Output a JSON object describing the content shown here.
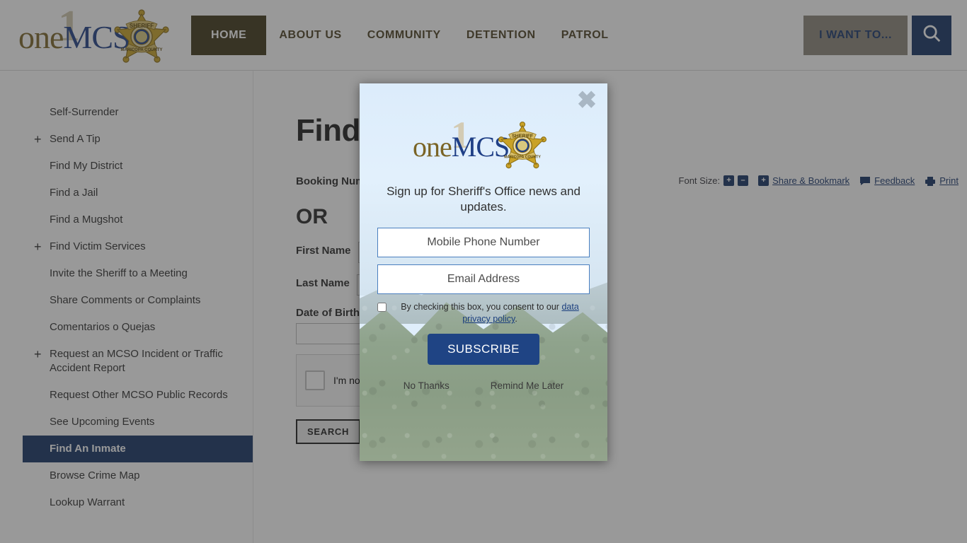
{
  "header": {
    "logo": {
      "digit": "1",
      "one": "one",
      "mcso": "MCSO",
      "badge_top": "SHERIFF",
      "badge_bottom": "MARICOPA COUNTY"
    },
    "nav": [
      {
        "label": "HOME",
        "active": true
      },
      {
        "label": "ABOUT US",
        "active": false
      },
      {
        "label": "COMMUNITY",
        "active": false
      },
      {
        "label": "DETENTION",
        "active": false
      },
      {
        "label": "PATROL",
        "active": false
      }
    ],
    "want_to_label": "I WANT TO...",
    "search_icon": "search-icon"
  },
  "sidebar": {
    "items": [
      {
        "label": "Self-Surrender",
        "expandable": false,
        "active": false
      },
      {
        "label": "Send A Tip",
        "expandable": true,
        "active": false
      },
      {
        "label": "Find My District",
        "expandable": false,
        "active": false
      },
      {
        "label": "Find a Jail",
        "expandable": false,
        "active": false
      },
      {
        "label": "Find a Mugshot",
        "expandable": false,
        "active": false
      },
      {
        "label": "Find Victim Services",
        "expandable": true,
        "active": false
      },
      {
        "label": "Invite the Sheriff to a Meeting",
        "expandable": false,
        "active": false
      },
      {
        "label": "Share Comments or Complaints",
        "expandable": false,
        "active": false
      },
      {
        "label": "Comentarios o Quejas",
        "expandable": false,
        "active": false
      },
      {
        "label": "Request an MCSO Incident or Traffic Accident Report",
        "expandable": true,
        "active": false
      },
      {
        "label": "Request Other MCSO Public Records",
        "expandable": false,
        "active": false
      },
      {
        "label": "See Upcoming Events",
        "expandable": false,
        "active": false
      },
      {
        "label": "Find An Inmate",
        "expandable": false,
        "active": true
      },
      {
        "label": "Browse Crime Map",
        "expandable": false,
        "active": false
      },
      {
        "label": "Lookup Warrant",
        "expandable": false,
        "active": false
      }
    ],
    "expand_glyph": "+"
  },
  "main": {
    "page_title": "Find An Inmate",
    "toolbar": {
      "font_size_label": "Font Size:",
      "font_increase": "+",
      "font_decrease": "–",
      "share_plus": "+",
      "share_label": "Share & Bookmark",
      "feedback_label": "Feedback",
      "print_label": "Print"
    },
    "form": {
      "booking_label": "Booking Number",
      "booking_value": "",
      "or_label": "OR",
      "first_name_label": "First Name",
      "first_name_value": "",
      "last_name_label": "Last Name",
      "last_name_value": "",
      "dob_label": "Date of Birth",
      "dob_value": "",
      "recaptcha_label": "I'm not a robot",
      "search_button": "SEARCH"
    }
  },
  "modal": {
    "close_glyph": "✖",
    "logo": {
      "digit": "1",
      "one": "one",
      "mcso": "MCSO"
    },
    "headline": "Sign up for Sheriff's Office news and updates.",
    "phone_placeholder": "Mobile Phone Number",
    "phone_value": "",
    "email_placeholder": "Email Address",
    "email_value": "",
    "consent_prefix": "By checking this box, you consent to our ",
    "consent_link": "data privacy policy",
    "consent_suffix": ".",
    "subscribe_label": "SUBSCRIBE",
    "no_thanks_label": "No Thanks",
    "remind_label": "Remind Me Later"
  },
  "colors": {
    "nav_active_bg": "#3d3517",
    "brand_navy": "#123163",
    "subscribe_blue": "#1f4484",
    "logo_gold": "#7a6426",
    "logo_blue": "#1f3f86",
    "overlay": "rgba(51,51,51,0.5)"
  }
}
